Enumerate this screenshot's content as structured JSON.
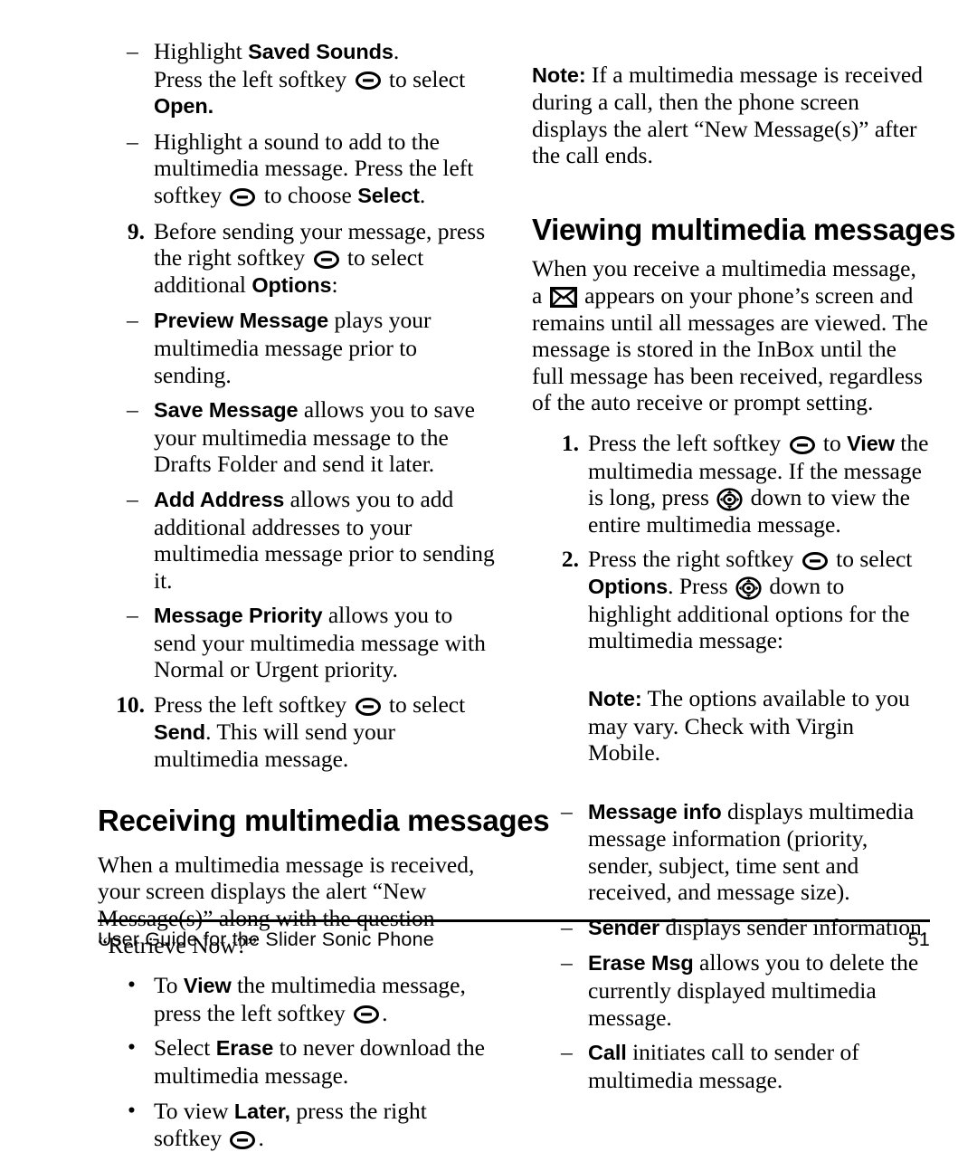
{
  "document": {
    "footer": {
      "text": "User Guide for the Slider Sonic Phone",
      "page_number": "51"
    }
  },
  "icons": {
    "softkey": "softkey-icon",
    "navkey": "navigation-key-icon",
    "envelope": "envelope-icon"
  },
  "left_column": {
    "sub_a_line1_pre": "Highlight ",
    "sub_a_line1_bold": "Saved Sounds",
    "sub_a_line1_post": ".",
    "sub_a_line2_pre": "Press the left softkey ",
    "sub_a_line2_mid": " to select ",
    "sub_a_line2_bold": "Open.",
    "sub_b_pre": "Highlight a sound to add to the multimedia message. Press the left softkey ",
    "sub_b_mid": " to choose ",
    "sub_b_bold": "Select",
    "sub_b_post": ".",
    "step9_num": "9.",
    "step9_pre": "Before sending your message, press the right softkey ",
    "step9_mid": " to select additional ",
    "step9_bold": "Options",
    "step9_post": ":",
    "opt1_bold": "Preview Message",
    "opt1_text": " plays your multimedia message prior to sending.",
    "opt2_bold": "Save Message",
    "opt2_text": " allows you to save your multimedia message to the Drafts Folder and send it later.",
    "opt3_bold": "Add Address",
    "opt3_text": " allows you to add additional addresses to your multimedia message prior to sending it.",
    "opt4_bold": "Message Priority",
    "opt4_text": " allows you to send your multimedia message with Normal or Urgent priority.",
    "step10_num": "10.",
    "step10_pre": "Press the left softkey ",
    "step10_mid": " to select ",
    "step10_bold": "Send",
    "step10_post": ". This will send your multimedia message.",
    "heading_receiving": "Receiving multimedia messages",
    "receiving_para": "When a multimedia message is received, your screen displays the alert “New Message(s)” along with the question “Retrieve Now?”",
    "bullet1_pre": "To ",
    "bullet1_bold": "View",
    "bullet1_mid": " the multimedia message, press the left softkey ",
    "bullet1_post": ".",
    "bullet2_pre": "Select ",
    "bullet2_bold": "Erase",
    "bullet2_post": " to never download the multimedia message.",
    "bullet3_pre": "To view ",
    "bullet3_bold": "Later,",
    "bullet3_mid": " press the right softkey ",
    "bullet3_post": "."
  },
  "right_column": {
    "note1_label": "Note:",
    "note1_text": "  If a multimedia message is received during a call, then the phone screen displays the alert “New Message(s)” after the call ends.",
    "heading_viewing": "Viewing multimedia messages",
    "viewing_para_pre": "When you receive a multimedia message, a ",
    "viewing_para_post": " appears on your phone’s screen and remains until all messages are viewed. The message is stored in the InBox until the full message has been received, regardless of the auto receive or prompt setting.",
    "step1_num": "1.",
    "step1_pre": "Press the left softkey ",
    "step1_mid1": " to ",
    "step1_bold": "View",
    "step1_mid2": " the multimedia message. If the message is long, press ",
    "step1_post": " down to view the entire multimedia message.",
    "step2_num": "2.",
    "step2_pre": "Press the right softkey ",
    "step2_mid1": " to select ",
    "step2_bold": "Options",
    "step2_mid2": ". Press ",
    "step2_post": " down to highlight additional options for the multimedia message:",
    "note2_label": "Note:",
    "note2_text": "  The options available to you may vary. Check with Virgin Mobile.",
    "opt1_bold": "Message info",
    "opt1_text": " displays multimedia message information (priority, sender, subject, time sent and received, and message size).",
    "opt2_bold": "Sender",
    "opt2_text": " displays sender information.",
    "opt3_bold": "Erase Msg",
    "opt3_text": " allows you to delete the currently displayed multimedia message.",
    "opt4_bold": "Call",
    "opt4_text": " initiates call to sender of multimedia message."
  }
}
